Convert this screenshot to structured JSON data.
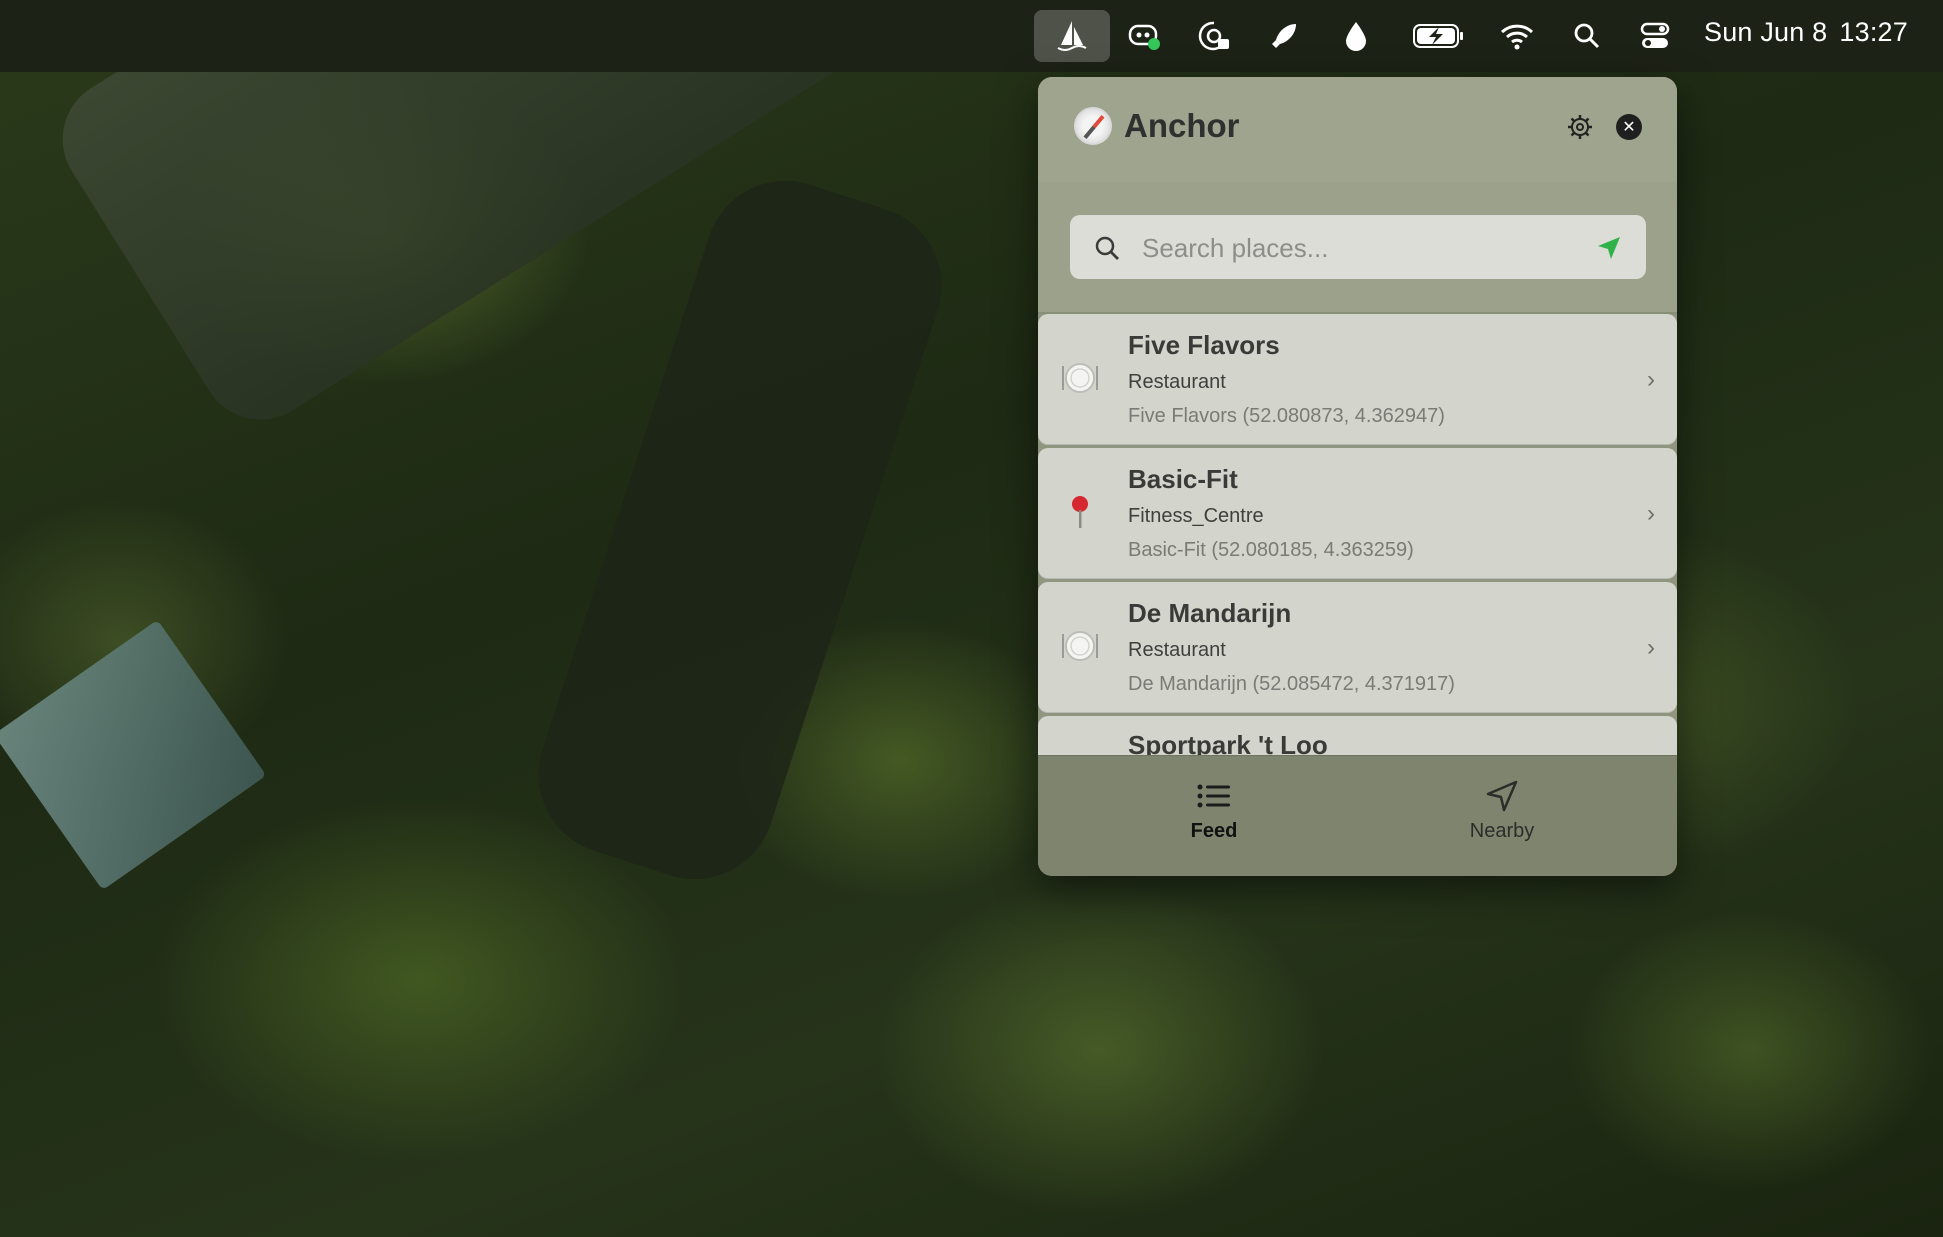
{
  "menubar": {
    "date": "Sun Jun 8",
    "time": "13:27",
    "icons": [
      "sailboat-icon",
      "copilot-icon",
      "lock-status-icon",
      "rocket-icon",
      "droplet-icon",
      "battery-charging-icon",
      "wifi-icon",
      "spotlight-search-icon",
      "control-center-icon"
    ]
  },
  "app": {
    "title": "Anchor",
    "icon": "compass-icon"
  },
  "search": {
    "placeholder": "Search places..."
  },
  "places": [
    {
      "name": "Five Flavors",
      "category": "Restaurant",
      "detail": "Five Flavors (52.080873, 4.362947)",
      "icon": "plate-icon"
    },
    {
      "name": "Basic-Fit",
      "category": "Fitness_Centre",
      "detail": "Basic-Fit (52.080185, 4.363259)",
      "icon": "pin-icon"
    },
    {
      "name": "De Mandarijn",
      "category": "Restaurant",
      "detail": "De Mandarijn (52.085472, 4.371917)",
      "icon": "plate-icon"
    },
    {
      "name": "Sportpark 't Loo"
    }
  ],
  "tabs": {
    "feed": "Feed",
    "nearby": "Nearby"
  },
  "colors": {
    "locate_accent": "#2fb24a",
    "pin": "#d7282f"
  }
}
